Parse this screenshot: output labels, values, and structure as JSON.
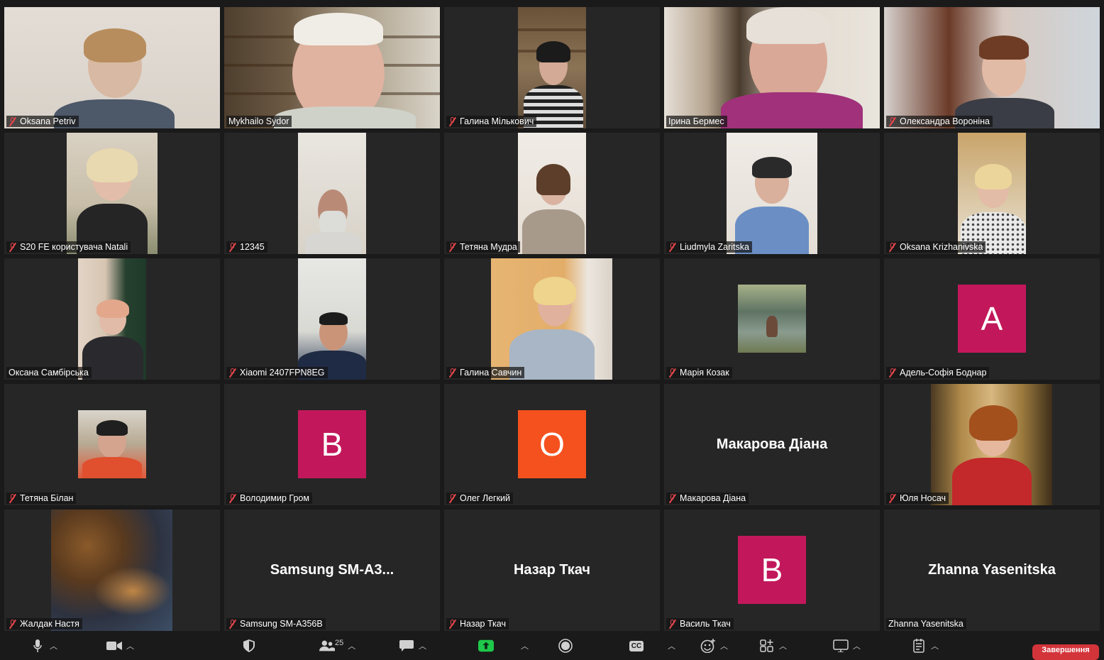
{
  "participants": [
    {
      "name": "Oksana Petriv",
      "muted": true,
      "display": "video"
    },
    {
      "name": "Mykhailo Sydor",
      "muted": false,
      "display": "video"
    },
    {
      "name": "Галина Мількович",
      "muted": true,
      "display": "video"
    },
    {
      "name": "Ірина Бермес",
      "muted": false,
      "display": "video",
      "active_speaker": true
    },
    {
      "name": "Олександра Вороніна",
      "muted": true,
      "display": "video"
    },
    {
      "name": "S20 FE користувача Natali",
      "muted": true,
      "display": "video"
    },
    {
      "name": "12345",
      "muted": true,
      "display": "video"
    },
    {
      "name": "Тетяна Мудра",
      "muted": true,
      "display": "video"
    },
    {
      "name": "Liudmyla Zaritska",
      "muted": true,
      "display": "video"
    },
    {
      "name": "Oksana Krizhanivska",
      "muted": true,
      "display": "video"
    },
    {
      "name": "Оксана Самбірська",
      "muted": false,
      "display": "video"
    },
    {
      "name": "Xiaomi 2407FPN8EG",
      "muted": true,
      "display": "video"
    },
    {
      "name": "Галина Савчин",
      "muted": true,
      "display": "video"
    },
    {
      "name": "Марія Козак",
      "muted": true,
      "display": "photo"
    },
    {
      "name": "Адель-Софія Боднар",
      "muted": true,
      "display": "avatar",
      "initial": "A",
      "avatar_color": "#c2185b"
    },
    {
      "name": "Тетяна Білан",
      "muted": true,
      "display": "photo"
    },
    {
      "name": "Володимир Гром",
      "muted": true,
      "display": "avatar",
      "initial": "B",
      "avatar_color": "#c2185b"
    },
    {
      "name": "Олег Легкий",
      "muted": true,
      "display": "avatar",
      "initial": "O",
      "avatar_color": "#f4511e"
    },
    {
      "name": "Макарова Діана",
      "muted": true,
      "display": "name",
      "big_name": "Макарова Діана"
    },
    {
      "name": "Юля Носач",
      "muted": true,
      "display": "photo"
    },
    {
      "name": "Жалдак Настя",
      "muted": true,
      "display": "photo"
    },
    {
      "name": "Samsung SM-A356B",
      "muted": true,
      "display": "name",
      "big_name": "Samsung  SM-A3..."
    },
    {
      "name": "Назар Ткач",
      "muted": true,
      "display": "name",
      "big_name": "Назар Ткач"
    },
    {
      "name": "Василь Ткач",
      "muted": true,
      "display": "avatar",
      "initial": "B",
      "avatar_color": "#c2185b"
    },
    {
      "name": "Zhanna Yasenitska",
      "muted": false,
      "display": "name",
      "big_name": "Zhanna Yasenitska"
    }
  ],
  "toolbar": {
    "participants_count": "25",
    "cc_label": "CC",
    "end_label": "Завершення",
    "items": [
      "mic-icon",
      "video-camera-icon",
      "security-shield-icon",
      "participants-icon",
      "chat-icon",
      "share-screen-icon",
      "record-icon",
      "closed-captions-icon",
      "reactions-icon",
      "apps-icon",
      "whiteboard-icon",
      "notes-icon"
    ]
  },
  "colors": {
    "background": "#1a1a1a",
    "tile_background": "#262626",
    "active_speaker_border": "#d7e64a",
    "muted_red": "#e5464c",
    "share_green": "#1ec84a",
    "end_red": "#d3343a"
  }
}
